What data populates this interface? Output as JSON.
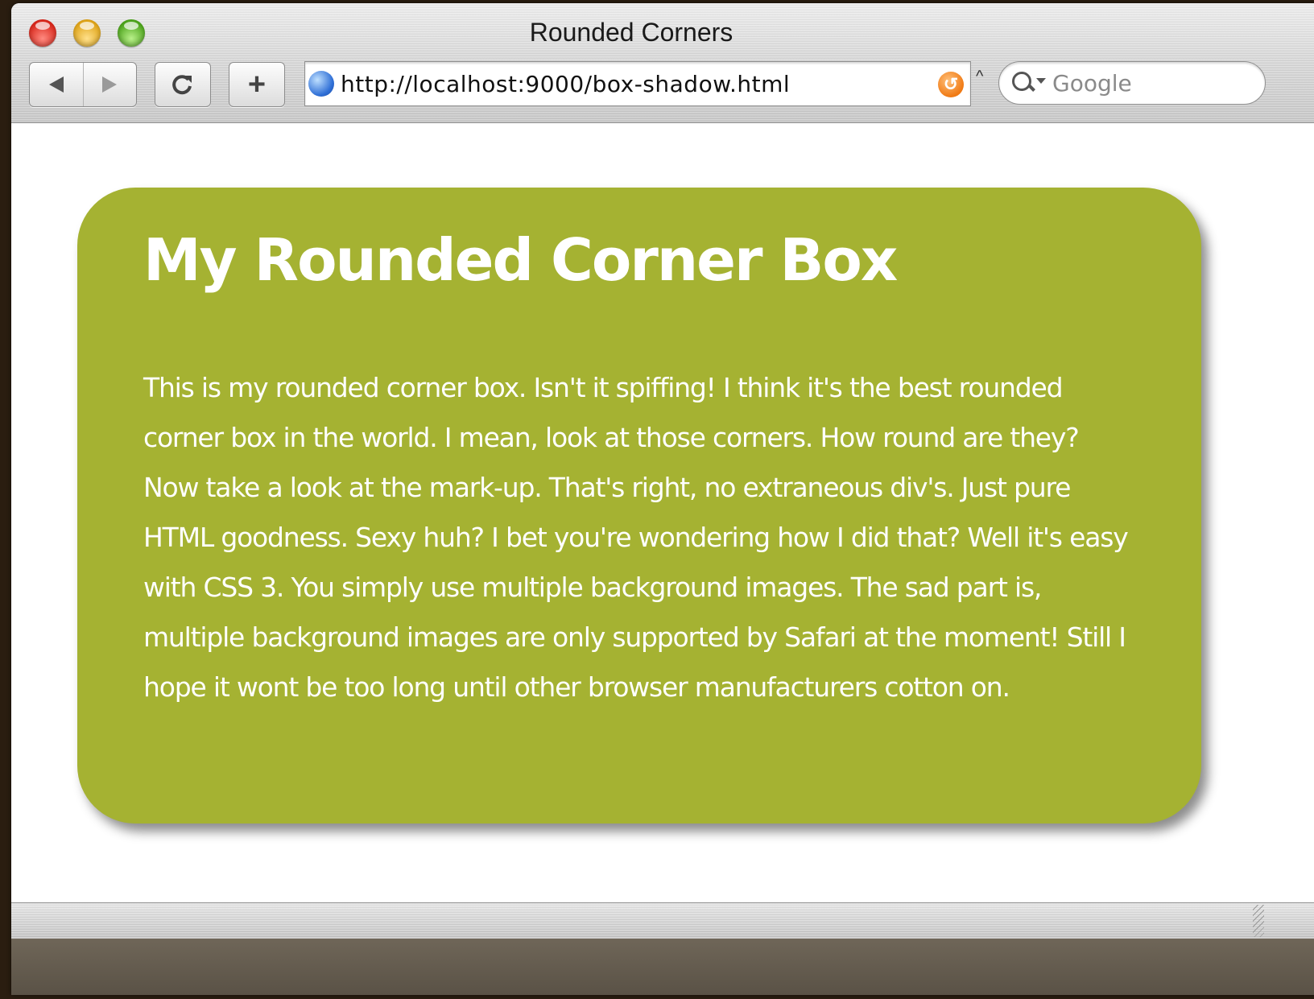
{
  "window": {
    "title": "Rounded Corners"
  },
  "toolbar": {
    "reload_icon": "reload-icon",
    "add_label": "+",
    "back_icon": "back-arrow-icon",
    "forward_icon": "forward-arrow-icon"
  },
  "address_bar": {
    "url": "http://localhost:9000/box-shadow.html",
    "rss_icon": "rss-icon"
  },
  "search": {
    "placeholder": "Google"
  },
  "page": {
    "heading": "My Rounded Corner Box",
    "body": "This is my rounded corner box. Isn't it spiffing! I think it's the best rounded corner box in the world. I mean, look at those corners. How round are they? Now take a look at the mark-up. That's right, no extraneous div's. Just pure HTML goodness. Sexy huh? I bet you're wondering how I did that? Well it's easy with CSS 3. You simply use multiple background images. The sad part is, multiple background images are only supported by Safari at the moment! Still I hope it wont be too long until other browser manufacturers cotton on."
  },
  "colors": {
    "box_background": "#a5b232",
    "box_text": "#ffffff",
    "page_background": "#ffffff"
  }
}
